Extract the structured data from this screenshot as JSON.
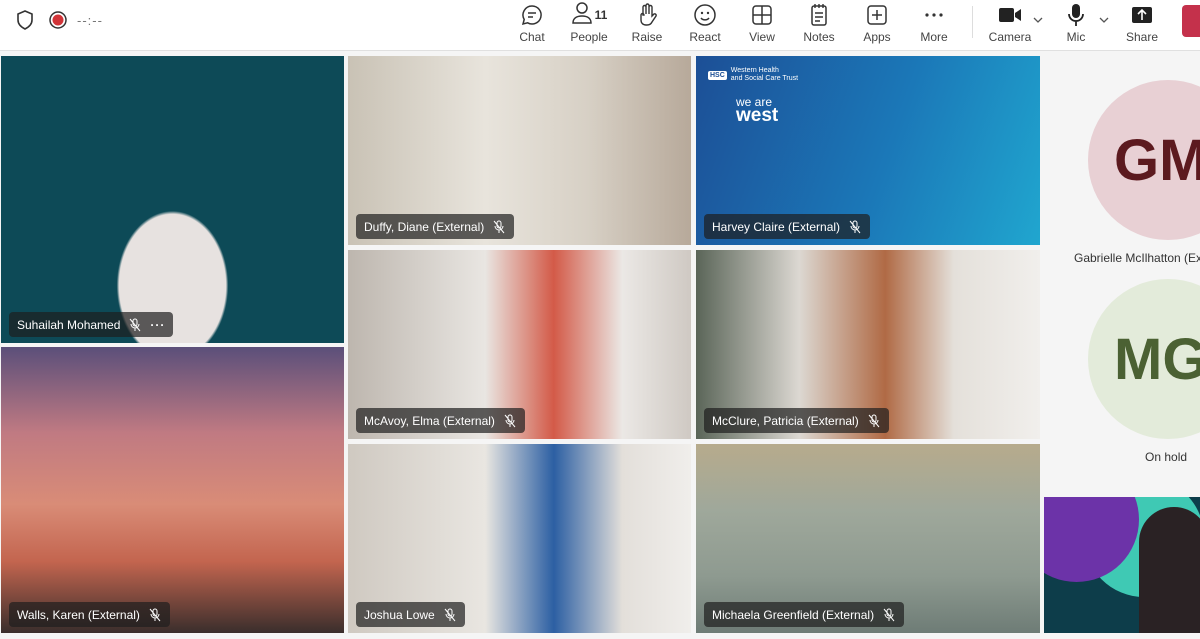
{
  "toolbar": {
    "timer": "--:--",
    "buttons": {
      "chat": "Chat",
      "people": "People",
      "people_count": "11",
      "raise": "Raise",
      "react": "React",
      "view": "View",
      "notes": "Notes",
      "apps": "Apps",
      "more": "More",
      "camera": "Camera",
      "mic": "Mic",
      "share": "Share"
    }
  },
  "participants": [
    {
      "name": "Suhailah Mohamed",
      "muted": true,
      "has_more": true
    },
    {
      "name": "Duffy, Diane (External)",
      "muted": true
    },
    {
      "name": "Harvey Claire (External)",
      "muted": true
    },
    {
      "name": "McAvoy, Elma (External)",
      "muted": true
    },
    {
      "name": "McClure, Patricia (External)",
      "muted": true
    },
    {
      "name": "Walls, Karen (External)",
      "muted": true
    },
    {
      "name": "Joshua Lowe",
      "muted": true
    },
    {
      "name": "Michaela Greenfield (External)",
      "muted": true
    }
  ],
  "side_panel": {
    "avatars": [
      {
        "initials": "GM",
        "label": "Gabrielle McIlhatton (External)",
        "bg": "#e8d0d4",
        "fg": "#5c1a1f"
      },
      {
        "initials": "MG",
        "label": "On hold",
        "bg": "#e3ebda",
        "fg": "#4b6133"
      }
    ]
  },
  "background": {
    "brand_text_1": "Western Health",
    "brand_text_2": "and Social Care Trust",
    "brand_badge": "HSC",
    "brand_slogan_1": "we are",
    "brand_slogan_2": "west"
  },
  "more_glyph": "···"
}
